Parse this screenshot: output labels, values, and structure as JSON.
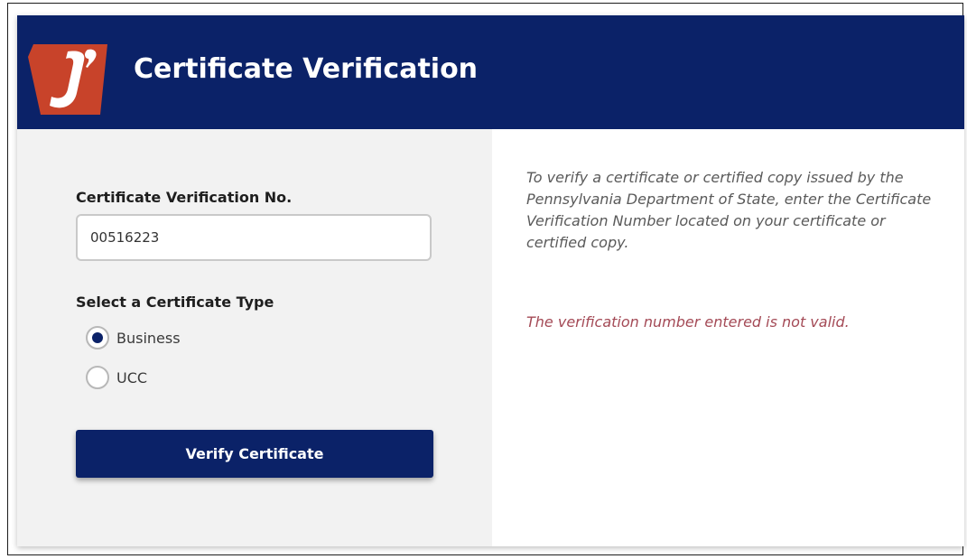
{
  "header": {
    "title": "Certificate Verification",
    "logo_icon": "pa-keystone-logo-icon",
    "background_color": "#0b2268",
    "logo_colors": {
      "keystone": "#c8432a",
      "letter": "#ffffff"
    }
  },
  "form": {
    "verification_label": "Certificate Verification No.",
    "verification_value": "00516223",
    "type_label": "Select a Certificate Type",
    "options": [
      {
        "label": "Business",
        "selected": true
      },
      {
        "label": "UCC",
        "selected": false
      }
    ],
    "verify_button_label": "Verify Certificate"
  },
  "info": {
    "instructions": "To verify a certificate or certified copy issued by the Pennsylvania Department of State, enter the Certificate Verification Number located on your certificate or certified copy.",
    "error_message": "The verification number entered is not valid.",
    "error_color": "#a44a56"
  }
}
